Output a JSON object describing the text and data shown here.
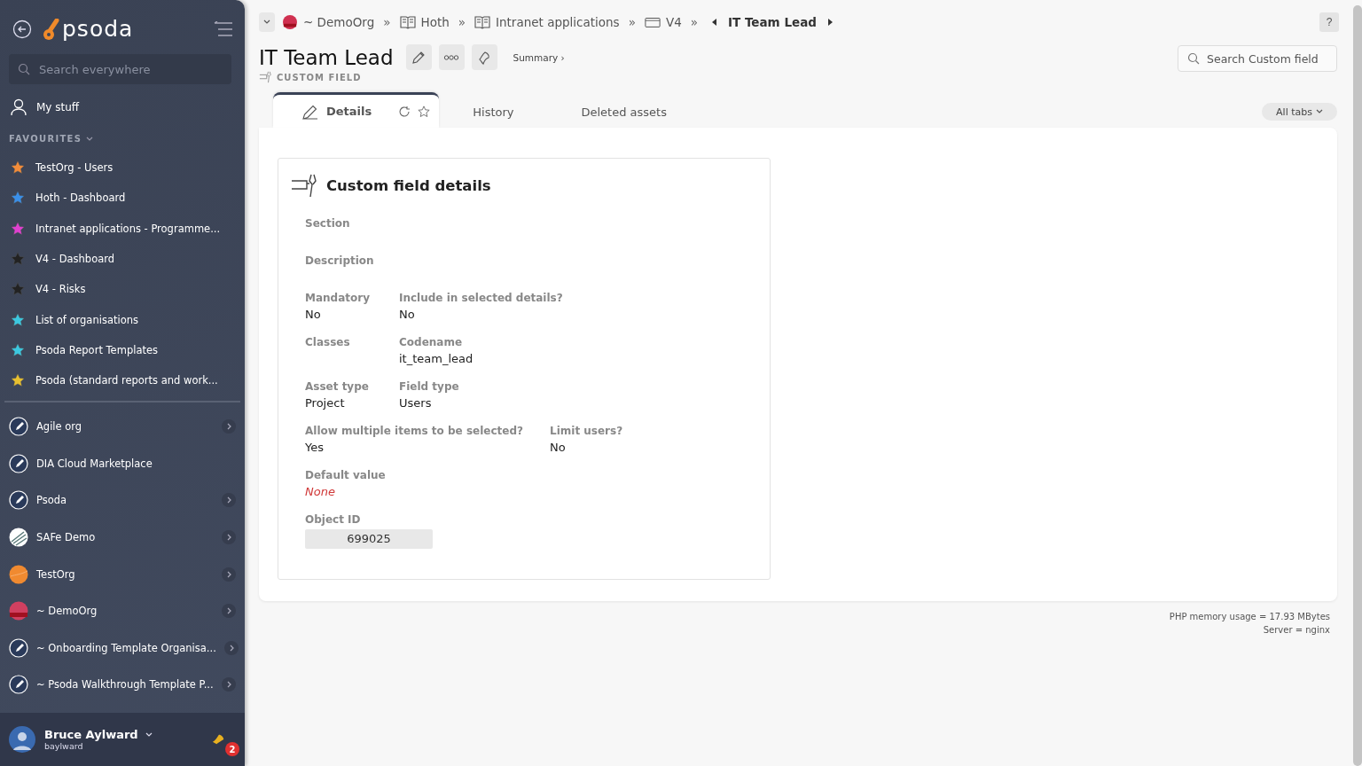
{
  "sidebar": {
    "logo": "psoda",
    "search": {
      "placeholder": "Search everywhere"
    },
    "my_stuff": "My stuff",
    "favourites_heading": "FAVOURITES",
    "favourites": [
      {
        "label": "TestOrg - Users",
        "color": "#f28c3a"
      },
      {
        "label": "Hoth - Dashboard",
        "color": "#3a8fe8"
      },
      {
        "label": "Intranet applications - Programme...",
        "color": "#e040d0"
      },
      {
        "label": "V4 - Dashboard",
        "color": "#222222"
      },
      {
        "label": "V4 - Risks",
        "color": "#222222"
      },
      {
        "label": "List of organisations",
        "color": "#3cc8e0"
      },
      {
        "label": "Psoda Report Templates",
        "color": "#3cc8e0"
      },
      {
        "label": "Psoda (standard reports and work...",
        "color": "#e8c030"
      }
    ],
    "organisations": [
      {
        "name": "Agile org",
        "kind": "rocket",
        "has_arrow": true
      },
      {
        "name": "DIA Cloud Marketplace",
        "kind": "rocket",
        "has_arrow": false
      },
      {
        "name": "Psoda",
        "kind": "rocket",
        "has_arrow": true
      },
      {
        "name": "SAFe Demo",
        "kind": "stripes",
        "has_arrow": true
      },
      {
        "name": "TestOrg",
        "kind": "orange",
        "has_arrow": true
      },
      {
        "name": "~ DemoOrg",
        "kind": "sunset",
        "has_arrow": true
      },
      {
        "name": "~ Onboarding Template Organisa...",
        "kind": "rocket",
        "has_arrow": true
      },
      {
        "name": "~ Psoda Walkthrough Template P...",
        "kind": "rocket",
        "has_arrow": true
      }
    ],
    "user": {
      "name": "Bruce Aylward",
      "username": "baylward",
      "notifications": "2"
    }
  },
  "breadcrumb": {
    "items": [
      {
        "label": "~ DemoOrg",
        "kind": "org",
        "separator": "»"
      },
      {
        "label": "Hoth",
        "kind": "book",
        "separator": "»"
      },
      {
        "label": "Intranet applications",
        "kind": "book",
        "separator": "»"
      },
      {
        "label": "V4",
        "kind": "folder",
        "separator": "»"
      }
    ],
    "current": "IT Team Lead"
  },
  "header": {
    "title": "IT Team Lead",
    "type": "CUSTOM FIELD",
    "summary": "Summary ›",
    "help": "?",
    "search": {
      "placeholder": "Search Custom field"
    }
  },
  "tabs": [
    {
      "label": "Details",
      "selected": true
    },
    {
      "label": "History",
      "selected": false
    },
    {
      "label": "Deleted assets",
      "selected": false
    }
  ],
  "all_tabs": "All tabs",
  "card": {
    "title": "Custom field details",
    "rows": [
      [
        {
          "label": "Section"
        }
      ],
      [
        {
          "label": "Description"
        }
      ],
      [
        {
          "label": "Mandatory",
          "value": "No"
        },
        {
          "label": "Include in selected details?",
          "value": "No"
        }
      ],
      [
        {
          "label": "Classes"
        },
        {
          "label": "Codename",
          "value": "it_team_lead"
        }
      ],
      [
        {
          "label": "Asset type",
          "value": "Project"
        },
        {
          "label": "Field type",
          "value": "Users"
        }
      ],
      [
        {
          "label": "Allow multiple items to be selected?",
          "value": "Yes"
        },
        {
          "label": "Limit users?",
          "value": "No"
        }
      ],
      [
        {
          "label": "Default value",
          "value": "None",
          "kind": "empty"
        }
      ],
      [
        {
          "label": "Object ID",
          "value": "699025",
          "kind": "id"
        }
      ]
    ]
  },
  "footer": [
    "PHP memory usage = 17.93 MBytes",
    "Server = nginx"
  ]
}
